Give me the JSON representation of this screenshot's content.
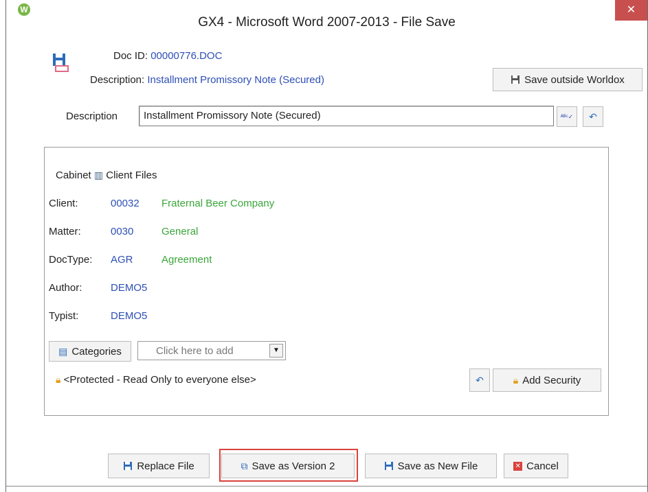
{
  "window": {
    "title": "GX4 - Microsoft Word 2007-2013 - File Save",
    "close_glyph": "✕",
    "app_icon_letter": "W"
  },
  "header": {
    "doc_id_label": "Doc ID:",
    "doc_id_value": "00000776.DOC",
    "description_label": "Description:",
    "description_value": "Installment Promissory Note (Secured)",
    "save_outside_label": "Save outside Worldox"
  },
  "description_field": {
    "label": "Description",
    "value": "Installment Promissory Note (Secured)"
  },
  "profile": {
    "cabinet_label": "Cabinet",
    "cabinet_value": "Client Files",
    "rows": [
      {
        "label": "Client:",
        "code": "00032",
        "name": "Fraternal Beer Company"
      },
      {
        "label": "Matter:",
        "code": "0030",
        "name": "General"
      },
      {
        "label": "DocType:",
        "code": "AGR",
        "name": "Agreement"
      },
      {
        "label": "Author:",
        "code": "DEMO5",
        "name": ""
      },
      {
        "label": "Typist:",
        "code": "DEMO5",
        "name": ""
      }
    ],
    "categories_label": "Categories",
    "categories_placeholder": "Click here to add",
    "security_text": "<Protected - Read Only to everyone else>",
    "add_security_label": "Add Security"
  },
  "buttons": {
    "replace_file": "Replace File",
    "save_as_version": "Save as Version 2",
    "save_as_new_file": "Save as New File",
    "cancel": "Cancel"
  },
  "colors": {
    "link_blue": "#2e4fb4",
    "name_green": "#3aa53a",
    "close_red": "#c7504f",
    "highlight_red": "#d9423c"
  }
}
